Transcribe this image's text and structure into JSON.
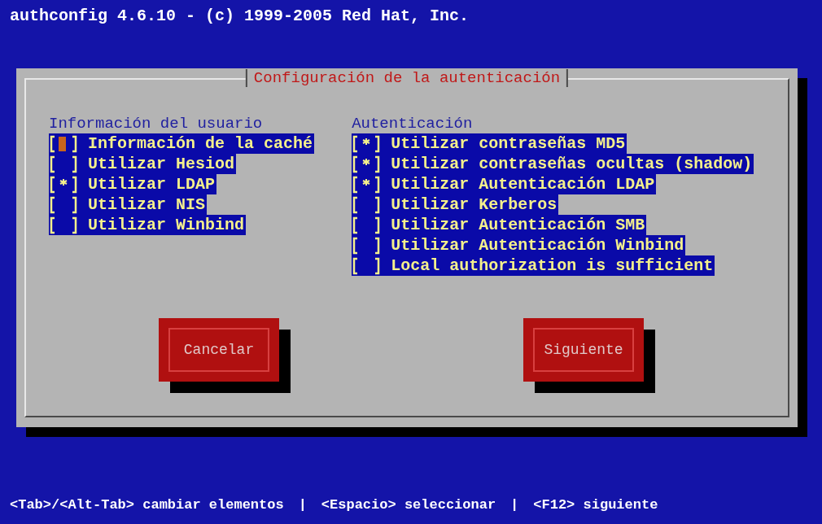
{
  "screen_title": "authconfig 4.6.10 - (c) 1999-2005 Red Hat, Inc.",
  "dialog": {
    "title": "Configuración de la autenticación",
    "columns": [
      {
        "heading": "Información del usuario",
        "items": [
          {
            "label": "Información de la caché",
            "checked": false,
            "focused": true
          },
          {
            "label": "Utilizar Hesiod",
            "checked": false,
            "focused": false
          },
          {
            "label": "Utilizar LDAP",
            "checked": true,
            "focused": false
          },
          {
            "label": "Utilizar NIS",
            "checked": false,
            "focused": false
          },
          {
            "label": "Utilizar Winbind",
            "checked": false,
            "focused": false
          }
        ]
      },
      {
        "heading": "Autenticación",
        "items": [
          {
            "label": "Utilizar contraseñas MD5",
            "checked": true,
            "focused": false
          },
          {
            "label": "Utilizar contraseñas ocultas (shadow)",
            "checked": true,
            "focused": false
          },
          {
            "label": "Utilizar Autenticación LDAP",
            "checked": true,
            "focused": false
          },
          {
            "label": "Utilizar Kerberos",
            "checked": false,
            "focused": false
          },
          {
            "label": "Utilizar Autenticación SMB",
            "checked": false,
            "focused": false
          },
          {
            "label": "Utilizar Autenticación Winbind",
            "checked": false,
            "focused": false
          },
          {
            "label": "Local authorization is sufficient",
            "checked": false,
            "focused": false
          }
        ]
      }
    ],
    "buttons": [
      "Cancelar",
      "Siguiente"
    ]
  },
  "help_line": [
    "<Tab>/<Alt-Tab> cambiar elementos",
    "|",
    "<Espacio> seleccionar",
    "|",
    "<F12> siguiente"
  ]
}
